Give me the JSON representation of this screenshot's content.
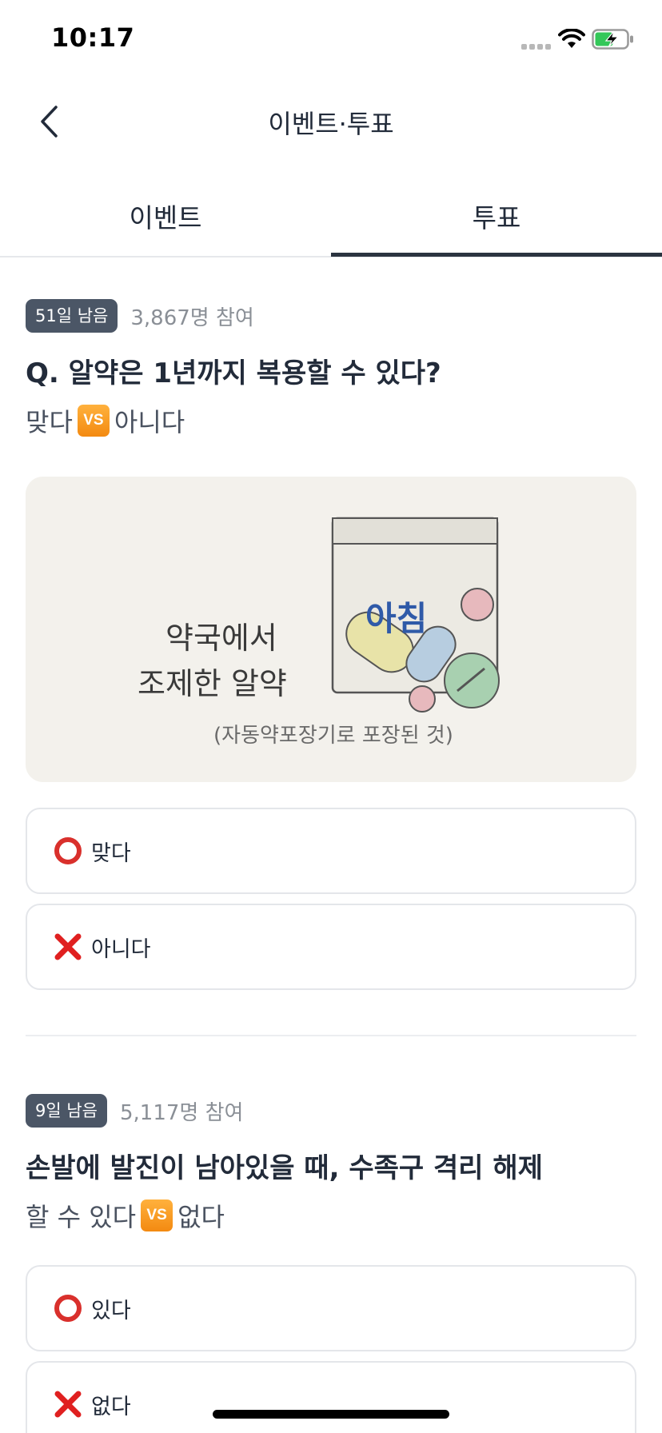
{
  "status_bar": {
    "time": "10:17"
  },
  "nav": {
    "title": "이벤트·투표"
  },
  "tabs": [
    {
      "label": "이벤트",
      "active": false
    },
    {
      "label": "투표",
      "active": true
    }
  ],
  "votes": [
    {
      "days_left": "51일 남음",
      "participants": "3,867명 참여",
      "question": "Q. 알약은 1년까지 복용할 수 있다?",
      "sub_left": "맞다",
      "vs": "VS",
      "sub_right": "아니다",
      "image": {
        "lines": [
          "약국에서",
          "조제한 알약",
          "(자동약포장기로 포장된 것)"
        ],
        "bag_text": "아침"
      },
      "options": [
        {
          "icon": "circle-icon",
          "label": "맞다"
        },
        {
          "icon": "cross-icon",
          "label": "아니다"
        }
      ]
    },
    {
      "days_left": "9일 남음",
      "participants": "5,117명 참여",
      "question": "손발에 발진이 남아있을 때, 수족구 격리 해제",
      "sub_left": "할 수 있다",
      "vs": "VS",
      "sub_right": "없다",
      "options": [
        {
          "icon": "circle-icon",
          "label": "있다"
        },
        {
          "icon": "cross-icon",
          "label": "없다"
        }
      ]
    }
  ],
  "colors": {
    "badge": "#4b5666",
    "tab_indicator": "#2b3440",
    "option_circle": "#d9302c",
    "option_cross": "#e02020",
    "vs_badge": "#f59a1e"
  }
}
